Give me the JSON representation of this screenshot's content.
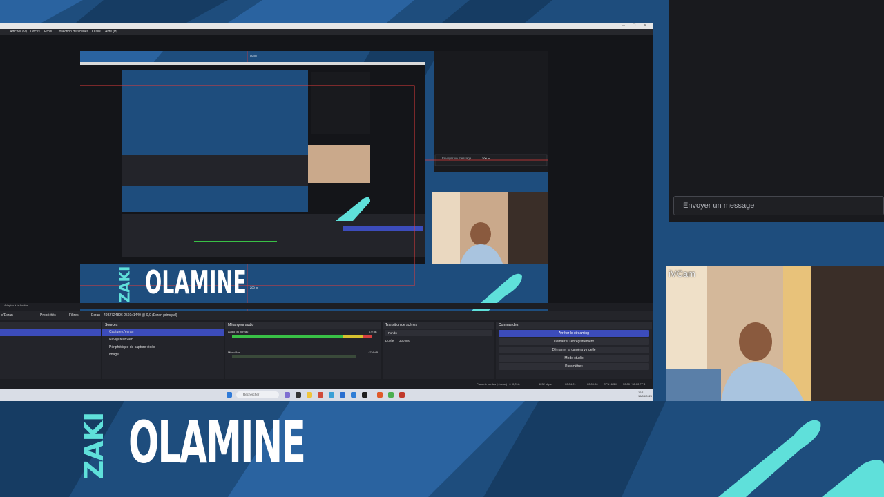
{
  "colors": {
    "background": "#1e4d7d",
    "accent_teal": "#5fe0da",
    "obs_dark": "#1d1e23",
    "obs_blue": "#3c4cbb"
  },
  "chat": {
    "placeholder": "Envoyer un message"
  },
  "webcam": {
    "label": "iVCam"
  },
  "logo": {
    "zaki": "ZAKI",
    "olamine": "OLAMINE"
  },
  "obs": {
    "menu": [
      "Afficher (V)",
      "Docks",
      "Profil",
      "Collection de scènes",
      "Outils",
      "Aide (H)"
    ],
    "dock_title": "Adapter à la fenêtre",
    "controls": {
      "screen": "d'Écran",
      "properties": "Propriétés",
      "filters": "Filtres",
      "ecran": "Écran",
      "display": "4982724896 2560x1440 @ 0,0 (Écran principal)"
    },
    "sources": {
      "title": "Sources",
      "items": [
        "Capture d'écran",
        "Navigateur web",
        "Périphérique de capture vidéo",
        "Image"
      ]
    },
    "mixer": {
      "title": "Mélangeur audio",
      "ch1": "Audio du bureau",
      "ch2": "Micro/Aux",
      "db1": "0.0 dB",
      "db2": "-47.4 dB"
    },
    "transitions": {
      "title": "Transition de scènes",
      "type": "Fondu",
      "duration_label": "Durée",
      "duration": "300 ms"
    },
    "commands": {
      "title": "Commandes",
      "start_stream": "Arrêter le streaming",
      "record": "Démarrer l'enregistrement",
      "virtual_cam": "Démarrer la caméra virtuelle",
      "studio": "Mode studio",
      "settings": "Paramètres"
    },
    "status": {
      "dropped": "Paquets perdus (réseau) : 0 (0,0%)",
      "bitrate": "6232 kbps",
      "time": "00:04:21",
      "rec": "00:00:00",
      "cpu": "CPU: 6.3%",
      "fps": "30.00 / 30.00 FPS"
    },
    "taskbar": {
      "search": "Rechercher",
      "time": "16:11",
      "date": "15/04/2025"
    }
  },
  "canvas": {
    "measure_top": "50 px",
    "measure_right": "300 px",
    "measure_bottom": "200 px",
    "logo_zaki": "ZAKI",
    "logo_olamine": "OLAMINE",
    "chat_placeholder": "Envoyer un message"
  }
}
